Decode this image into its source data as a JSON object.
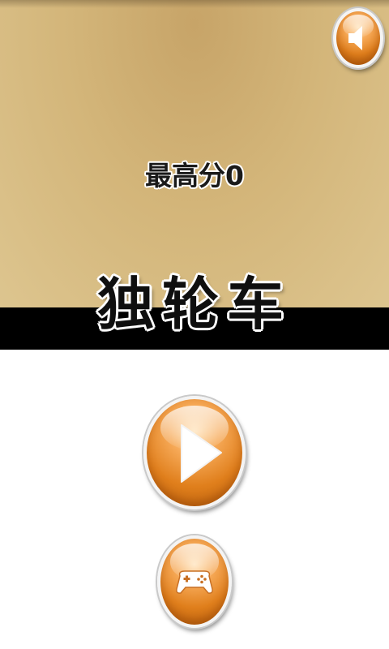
{
  "screen": {
    "best_score_label": "最高分",
    "best_score_value": "0",
    "game_title": "独轮车"
  },
  "buttons": {
    "sound": {
      "icon": "speaker-icon"
    },
    "play": {
      "icon": "play-icon"
    },
    "controller": {
      "icon": "gamepad-icon"
    }
  },
  "colors": {
    "top_panel": "#d3b579",
    "title_band": "#000000",
    "button_orange": "#e07f1c",
    "button_rim": "#f4f4f4"
  }
}
